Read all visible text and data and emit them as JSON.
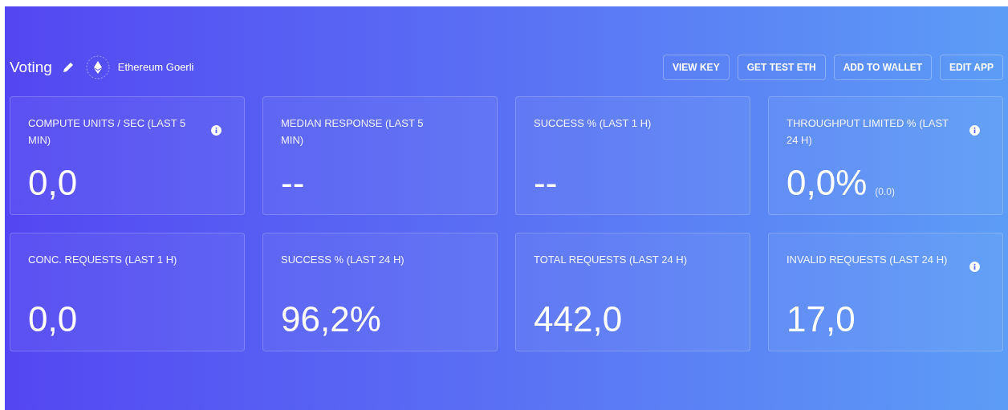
{
  "app": {
    "name": "Voting",
    "network": "Ethereum Goerli"
  },
  "buttons": [
    "VIEW KEY",
    "GET TEST ETH",
    "ADD TO WALLET",
    "EDIT APP"
  ],
  "cards": [
    {
      "label": "COMPUTE UNITS / SEC (LAST 5 MIN)",
      "value": "0,0",
      "info": true
    },
    {
      "label": "MEDIAN RESPONSE (LAST 5 MIN)",
      "value": "--",
      "info": false
    },
    {
      "label": "SUCCESS % (LAST 1 H)",
      "value": "--",
      "info": false
    },
    {
      "label": "THROUGHPUT LIMITED % (LAST 24 H)",
      "value": "0,0%",
      "sub": "(0.0)",
      "info": true
    },
    {
      "label": "CONC. REQUESTS (LAST 1 H)",
      "value": "0,0",
      "info": false
    },
    {
      "label": "SUCCESS % (LAST 24 H)",
      "value": "96,2%",
      "info": false
    },
    {
      "label": "TOTAL REQUESTS (LAST 24 H)",
      "value": "442,0",
      "info": false
    },
    {
      "label": "INVALID REQUESTS (LAST 24 H)",
      "value": "17,0",
      "info": true
    }
  ]
}
